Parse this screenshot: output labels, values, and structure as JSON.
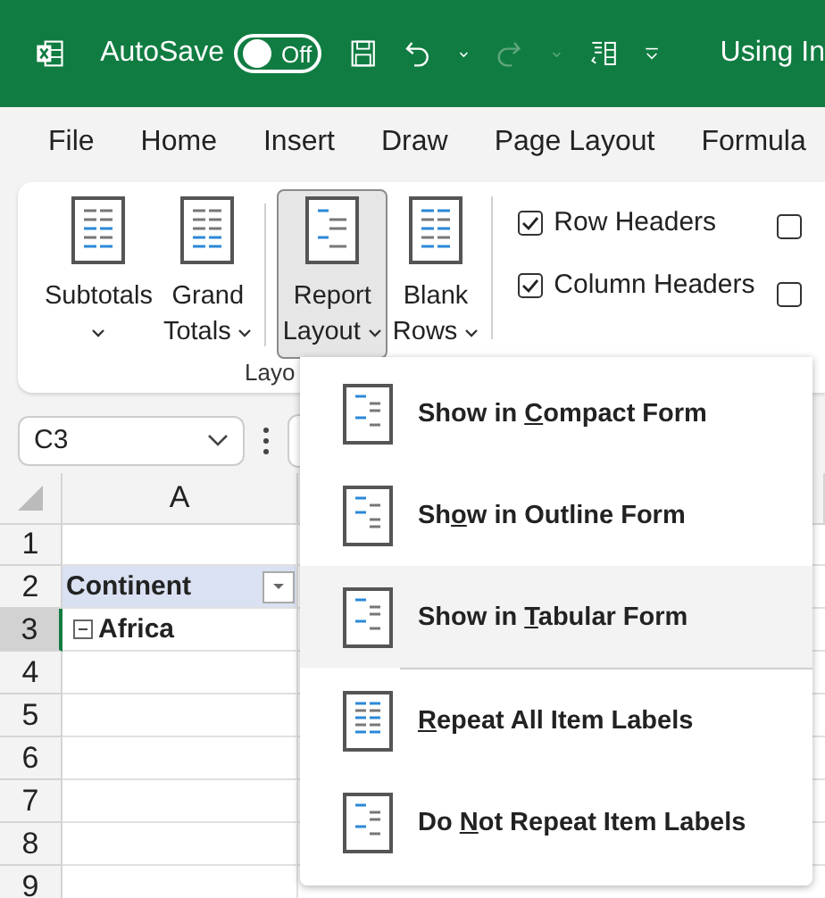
{
  "title_bar": {
    "autosave_label": "AutoSave",
    "autosave_toggle": {
      "on": false,
      "text": "Off"
    },
    "redo_disabled": true,
    "document_title": "Using In"
  },
  "tabs": [
    {
      "label": "File",
      "selected": false
    },
    {
      "label": "Home",
      "selected": false
    },
    {
      "label": "Insert",
      "selected": false
    },
    {
      "label": "Draw",
      "selected": false
    },
    {
      "label": "Page Layout",
      "selected": false
    },
    {
      "label": "Formula",
      "selected": false
    }
  ],
  "ribbon": {
    "buttons": [
      {
        "label_lines": [
          "Subtotals"
        ],
        "pressed": false
      },
      {
        "label_lines": [
          "Grand",
          "Totals"
        ],
        "pressed": false
      },
      {
        "label_lines": [
          "Report",
          "Layout"
        ],
        "pressed": true
      },
      {
        "label_lines": [
          "Blank",
          "Rows"
        ],
        "pressed": false
      }
    ],
    "group_label": "Layo",
    "checkboxes": [
      {
        "label": "Row Headers",
        "checked": true
      },
      {
        "label": "Column Headers",
        "checked": true
      }
    ],
    "checkboxes_column_2": [
      {
        "checked": false
      },
      {
        "checked": false
      }
    ]
  },
  "name_box": {
    "value": "C3"
  },
  "sheet": {
    "column_headers": [
      "A"
    ],
    "rows": [
      {
        "number": "1",
        "selected": false,
        "cell": "",
        "kind": "plain"
      },
      {
        "number": "2",
        "selected": false,
        "cell": "Continent",
        "kind": "header"
      },
      {
        "number": "3",
        "selected": true,
        "cell": "Africa",
        "kind": "group"
      },
      {
        "number": "4",
        "selected": false,
        "cell": "",
        "kind": "plain"
      },
      {
        "number": "5",
        "selected": false,
        "cell": "",
        "kind": "plain"
      },
      {
        "number": "6",
        "selected": false,
        "cell": "",
        "kind": "plain"
      },
      {
        "number": "7",
        "selected": false,
        "cell": "",
        "kind": "plain"
      },
      {
        "number": "8",
        "selected": false,
        "cell": "",
        "kind": "plain"
      },
      {
        "number": "9",
        "selected": false,
        "cell": "",
        "kind": "plain"
      }
    ]
  },
  "menu": {
    "items": [
      {
        "kind": "compact",
        "before": "Show in ",
        "key": "C",
        "after": "ompact Form",
        "selected": false
      },
      {
        "kind": "outline",
        "before": "Sh",
        "key": "o",
        "after": "w in Outline Form",
        "selected": false
      },
      {
        "kind": "tabular",
        "before": "Show in ",
        "key": "T",
        "after": "abular Form",
        "selected": true
      },
      {
        "kind": "repeat",
        "key": "R",
        "after": "epeat All Item Labels",
        "selected": false
      },
      {
        "kind": "norepeat",
        "before": "Do ",
        "key": "N",
        "after": "ot Repeat Item Labels",
        "selected": false
      }
    ]
  }
}
